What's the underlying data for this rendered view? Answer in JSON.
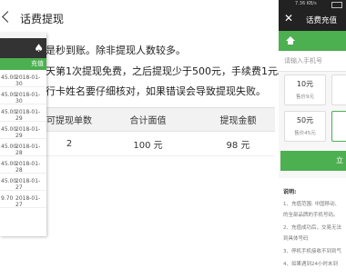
{
  "center": {
    "title": "话费提现",
    "notes": [
      "是秒到账。除非提现人数较多。",
      "天第1次提现免费，之后提现少于500元，手续费1元。",
      "行卡姓名要仔细核对，如果错误会导致提现失败。"
    ],
    "table": {
      "headers": [
        "可提现单数",
        "合计面值",
        "提现金额"
      ],
      "row": [
        "2",
        "100 元",
        "98 元"
      ]
    }
  },
  "left_phone": {
    "header_label": "充值",
    "rows": [
      {
        "amount": "45.00",
        "date": "2018-01-30"
      },
      {
        "amount": "45.00",
        "date": "2018-01-30"
      },
      {
        "amount": "45.00",
        "date": "2018-01-29"
      },
      {
        "amount": "45.00",
        "date": "2018-01-29"
      },
      {
        "amount": "45.00",
        "date": "2018-01-28"
      },
      {
        "amount": "45.00",
        "date": "2018-01-28"
      },
      {
        "amount": "45.00",
        "date": "2018-01-27"
      },
      {
        "amount": "9.70",
        "date": "2018-01-27"
      }
    ]
  },
  "right_phone": {
    "status_text": "7.36 KB/s",
    "title": "话费充值",
    "phone_placeholder": "请输入手机号",
    "cards": [
      {
        "value": "10元",
        "price": "售价9元"
      },
      {
        "value": "50元",
        "price": "售价45元"
      }
    ],
    "submit_label": "立",
    "notes_heading": "说明:",
    "notes": [
      "1、充值范围: 中国移动、",
      "的全部品牌的手机号码。",
      "2、充值成功后，交易无法",
      "到具体号码",
      "3、停机手机接收不到到气",
      "4、如果遇到24小时未到"
    ]
  },
  "colors": {
    "accent_green": "#4caf50",
    "dark_bar": "#222222"
  }
}
